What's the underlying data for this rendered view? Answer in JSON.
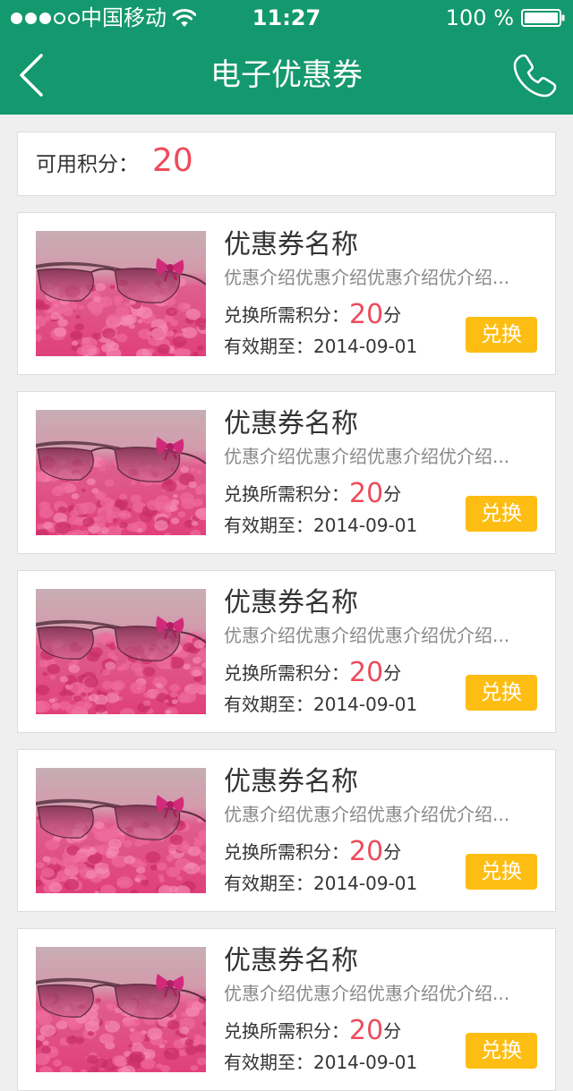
{
  "status_bar": {
    "signal_filled": 3,
    "signal_total": 5,
    "carrier": "中国移动",
    "time": "11:27",
    "battery": "100 %"
  },
  "nav": {
    "title": "电子优惠券",
    "back_icon": "chevron-left-icon",
    "phone_icon": "phone-icon"
  },
  "points": {
    "label": "可用积分：",
    "value": "20"
  },
  "coupon_labels": {
    "cost_prefix": "兑换所需积分：",
    "cost_unit": "分",
    "expiry_prefix": "有效期至：",
    "redeem": "兑换"
  },
  "coupons": [
    {
      "name": "优惠券名称",
      "description": "优惠介绍优惠介绍优惠介绍优介绍...",
      "cost": "20",
      "expiry": "2014-09-01"
    },
    {
      "name": "优惠券名称",
      "description": "优惠介绍优惠介绍优惠介绍优介绍...",
      "cost": "20",
      "expiry": "2014-09-01"
    },
    {
      "name": "优惠券名称",
      "description": "优惠介绍优惠介绍优惠介绍优介绍...",
      "cost": "20",
      "expiry": "2014-09-01"
    },
    {
      "name": "优惠券名称",
      "description": "优惠介绍优惠介绍优惠介绍优介绍...",
      "cost": "20",
      "expiry": "2014-09-01"
    },
    {
      "name": "优惠券名称",
      "description": "优惠介绍优惠介绍优惠介绍优介绍...",
      "cost": "20",
      "expiry": "2014-09-01"
    }
  ],
  "colors": {
    "header": "#14986e",
    "accent_red": "#ee4b5b",
    "redeem_button": "#fdbd12",
    "background": "#efefef"
  }
}
